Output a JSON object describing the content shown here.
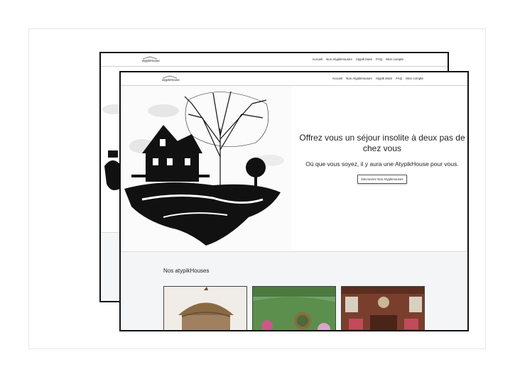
{
  "site": {
    "logo_text": "atypikHouse"
  },
  "nav": {
    "items": [
      "Accueil",
      "Nos AtypikHouses",
      "Atypik team",
      "FAQ",
      "Mon compte"
    ]
  },
  "hero": {
    "title": "Offrez vous un séjour insolite à deux pas de chez vous",
    "subtitle": "Où que vous soyez, il y aura une AtypikHouse pour vous.",
    "cta_label": "Découvrez Nos AtypikHouses"
  },
  "houses": {
    "heading": "Nos atypikHouses",
    "thumbnails": [
      "thatched-hut-image",
      "hobbit-house-image",
      "train-interior-image"
    ]
  },
  "colors": {
    "frame_border": "#111111",
    "section_bg": "#f4f5f6"
  }
}
